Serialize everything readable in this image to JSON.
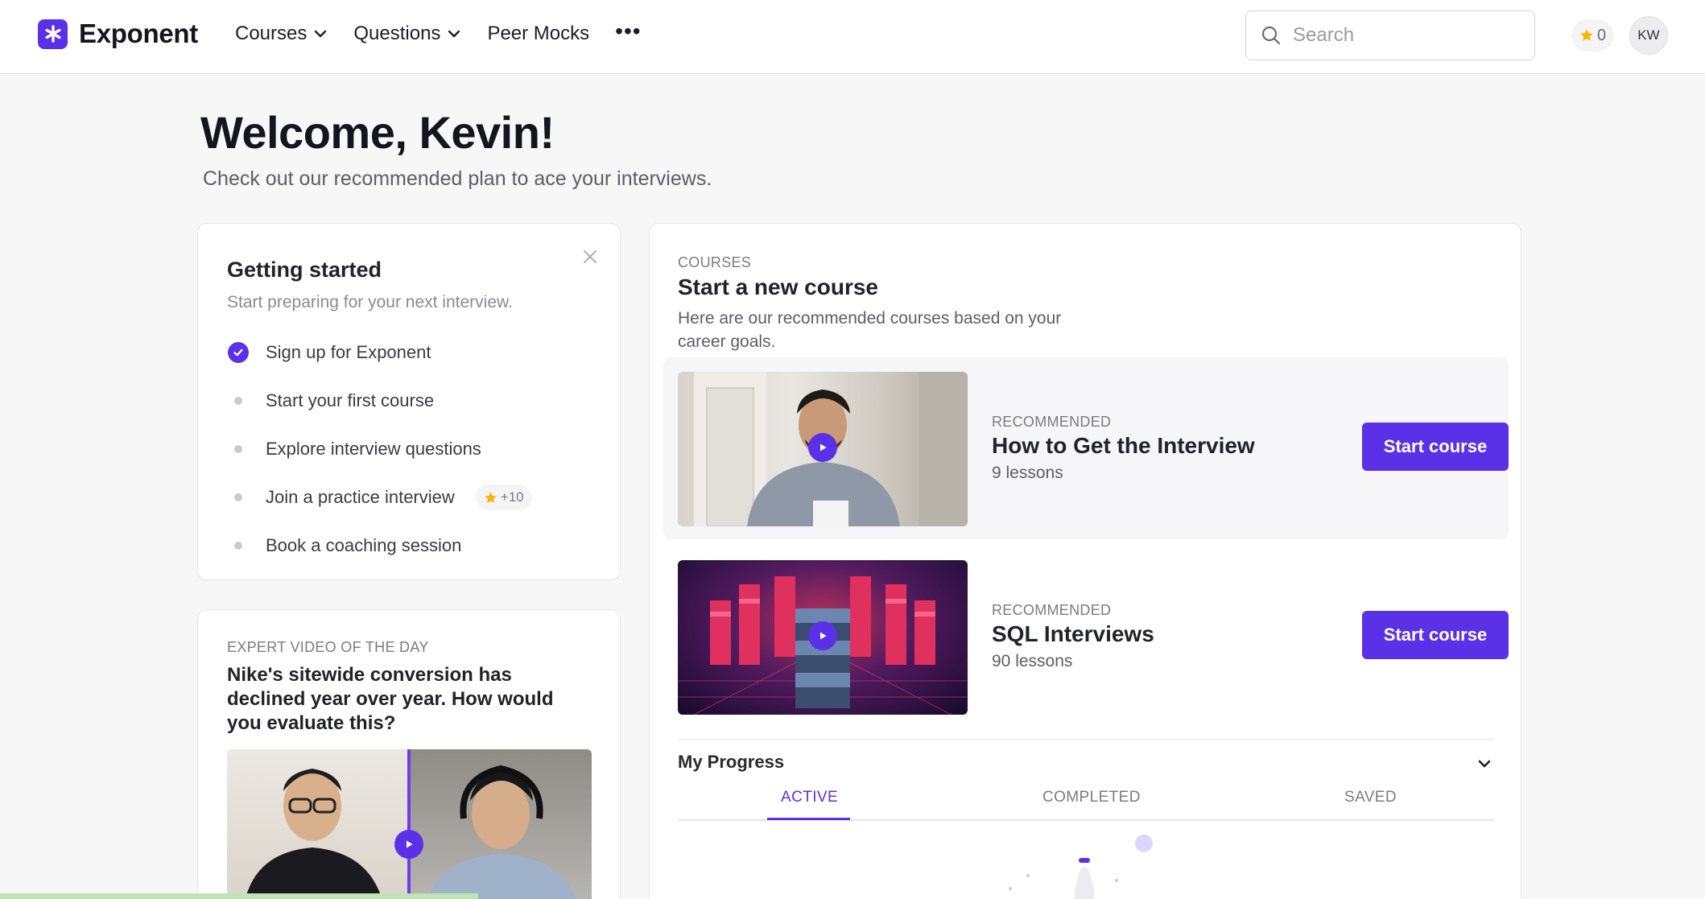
{
  "nav": {
    "brand": "Exponent",
    "links": [
      {
        "label": "Courses"
      },
      {
        "label": "Questions"
      },
      {
        "label": "Peer Mocks"
      }
    ],
    "more": "•••",
    "search_placeholder": "Search",
    "points": "0",
    "avatar_initials": "KW"
  },
  "welcome": {
    "title": "Welcome, Kevin!",
    "subtitle": "Check out our recommended plan to ace your interviews."
  },
  "getting_started": {
    "title": "Getting started",
    "subtitle": "Start preparing for your next interview.",
    "items": [
      {
        "label": "Sign up for Exponent",
        "done": true
      },
      {
        "label": "Start your first course",
        "done": false
      },
      {
        "label": "Explore interview questions",
        "done": false
      },
      {
        "label": "Join a practice interview",
        "done": false,
        "badge": "+10"
      },
      {
        "label": "Book a coaching session",
        "done": false
      }
    ]
  },
  "expert_video": {
    "kicker": "EXPERT VIDEO OF THE DAY",
    "title": "Nike's sitewide conversion has declined year over year. How would you evaluate this?"
  },
  "courses": {
    "kicker": "COURSES",
    "title": "Start a new course",
    "subtitle": "Here are our recommended courses based on your career goals.",
    "list": [
      {
        "kicker": "RECOMMENDED",
        "name": "How to Get the Interview",
        "lessons": "9 lessons",
        "button": "Start course"
      },
      {
        "kicker": "RECOMMENDED",
        "name": "SQL Interviews",
        "lessons": "90 lessons",
        "button": "Start course"
      }
    ]
  },
  "progress": {
    "title": "My Progress",
    "tabs": [
      {
        "label": "ACTIVE",
        "active": true
      },
      {
        "label": "COMPLETED",
        "active": false
      },
      {
        "label": "SAVED",
        "active": false
      }
    ]
  },
  "colors": {
    "accent": "#5b31e8",
    "star": "#f5b400"
  }
}
